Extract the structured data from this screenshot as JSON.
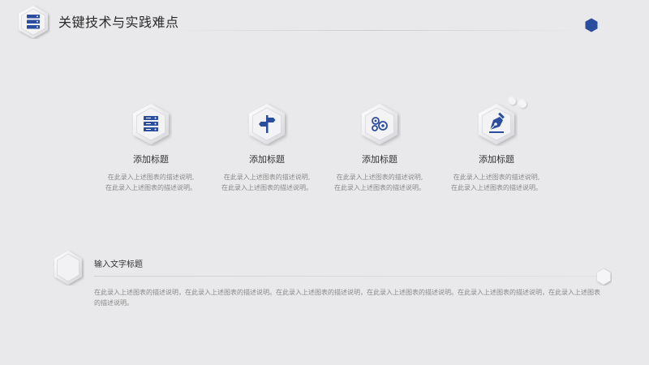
{
  "header": {
    "title": "关键技术与实践难点"
  },
  "colors": {
    "accent": "#2b4da0",
    "background": "#e9e9eb",
    "hex_face": "#f3f3f5"
  },
  "features": [
    {
      "icon": "server-icon",
      "title": "添加标题",
      "desc_line1": "在此录入上述图表的描述说明,",
      "desc_line2": "在此录入上述图表的描述说明。"
    },
    {
      "icon": "signpost-icon",
      "title": "添加标题",
      "desc_line1": "在此录入上述图表的描述说明,",
      "desc_line2": "在此录入上述图表的描述说明。"
    },
    {
      "icon": "gears-icon",
      "title": "添加标题",
      "desc_line1": "在此录入上述图表的描述说明,",
      "desc_line2": "在此录入上述图表的描述说明。"
    },
    {
      "icon": "pen-icon",
      "title": "添加标题",
      "desc_line1": "在此录入上述图表的描述说明,",
      "desc_line2": "在此录入上述图表的描述说明。"
    }
  ],
  "bottom": {
    "title": "输入文字标题",
    "desc": "在此录入上述图表的描述说明，在此录入上述图表的描述说明。在此录入上述图表的描述说明，在此录入上述图表的描述说明。在此录入上述图表的描述说明，在此录入上述图表的描述说明。"
  }
}
